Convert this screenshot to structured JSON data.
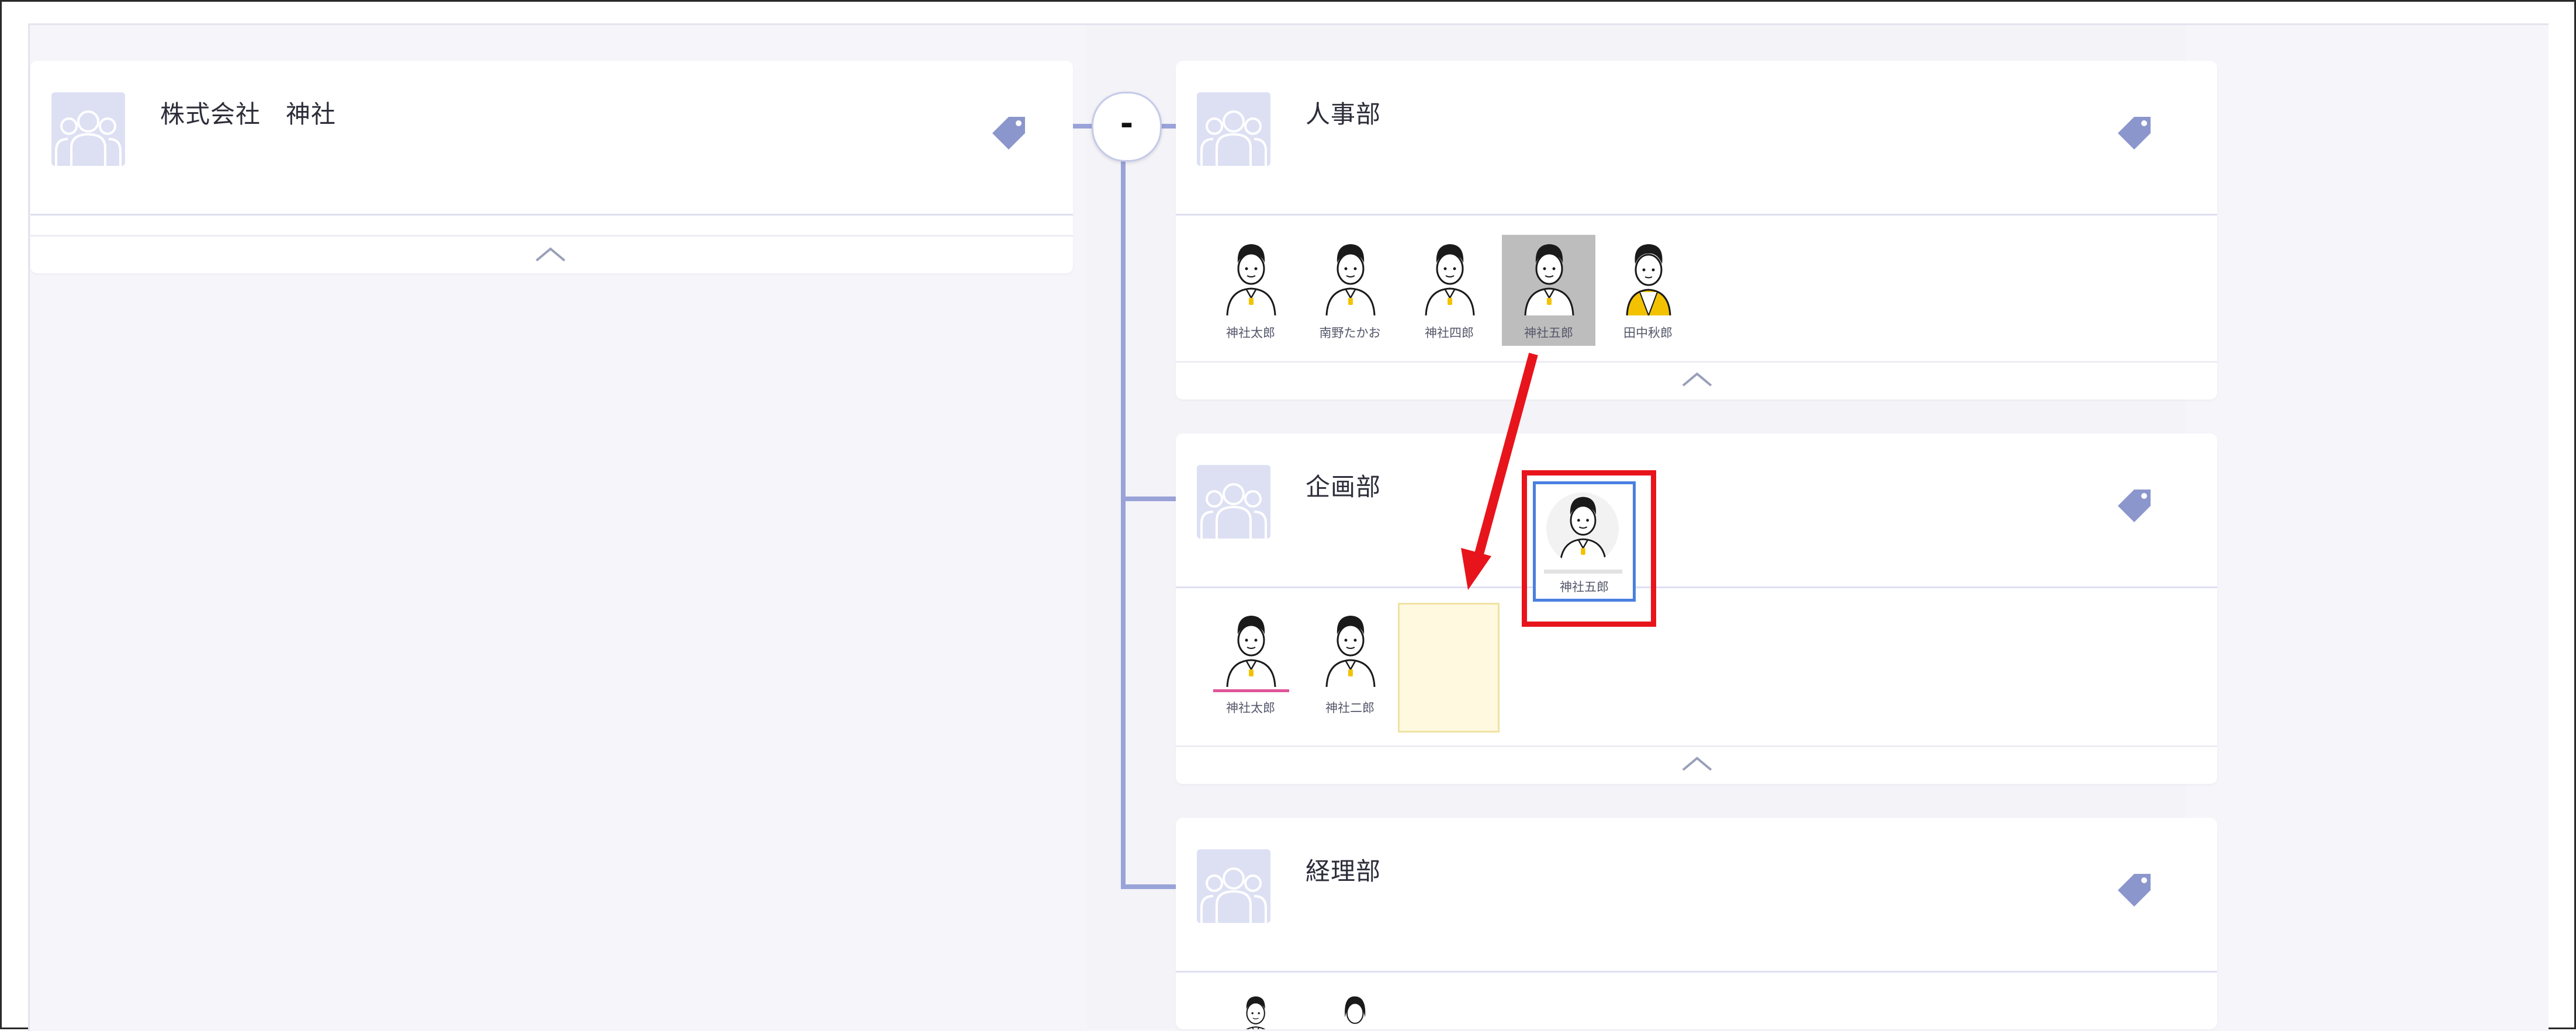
{
  "company": {
    "title": "株式会社　神社"
  },
  "toggle": {
    "label": "-"
  },
  "departments": [
    {
      "title": "人事部",
      "members": [
        "神社太郎",
        "南野たかお",
        "神社四郎",
        "神社五郎",
        "田中秋郎"
      ]
    },
    {
      "title": "企画部",
      "members": [
        "神社太郎",
        "神社二郎"
      ]
    },
    {
      "title": "経理部",
      "members": []
    }
  ],
  "dragging": {
    "name": "神社五郎"
  },
  "colors": {
    "connector": "#99a3d8",
    "drag_highlight": "#e8141c",
    "drop_zone": "#fff9e0",
    "tag_icon": "#8b96cc",
    "avatar_placeholder": "#dde0f3"
  },
  "icons": [
    "people-placeholder-icon",
    "tag-icon",
    "chevron-up-icon"
  ]
}
